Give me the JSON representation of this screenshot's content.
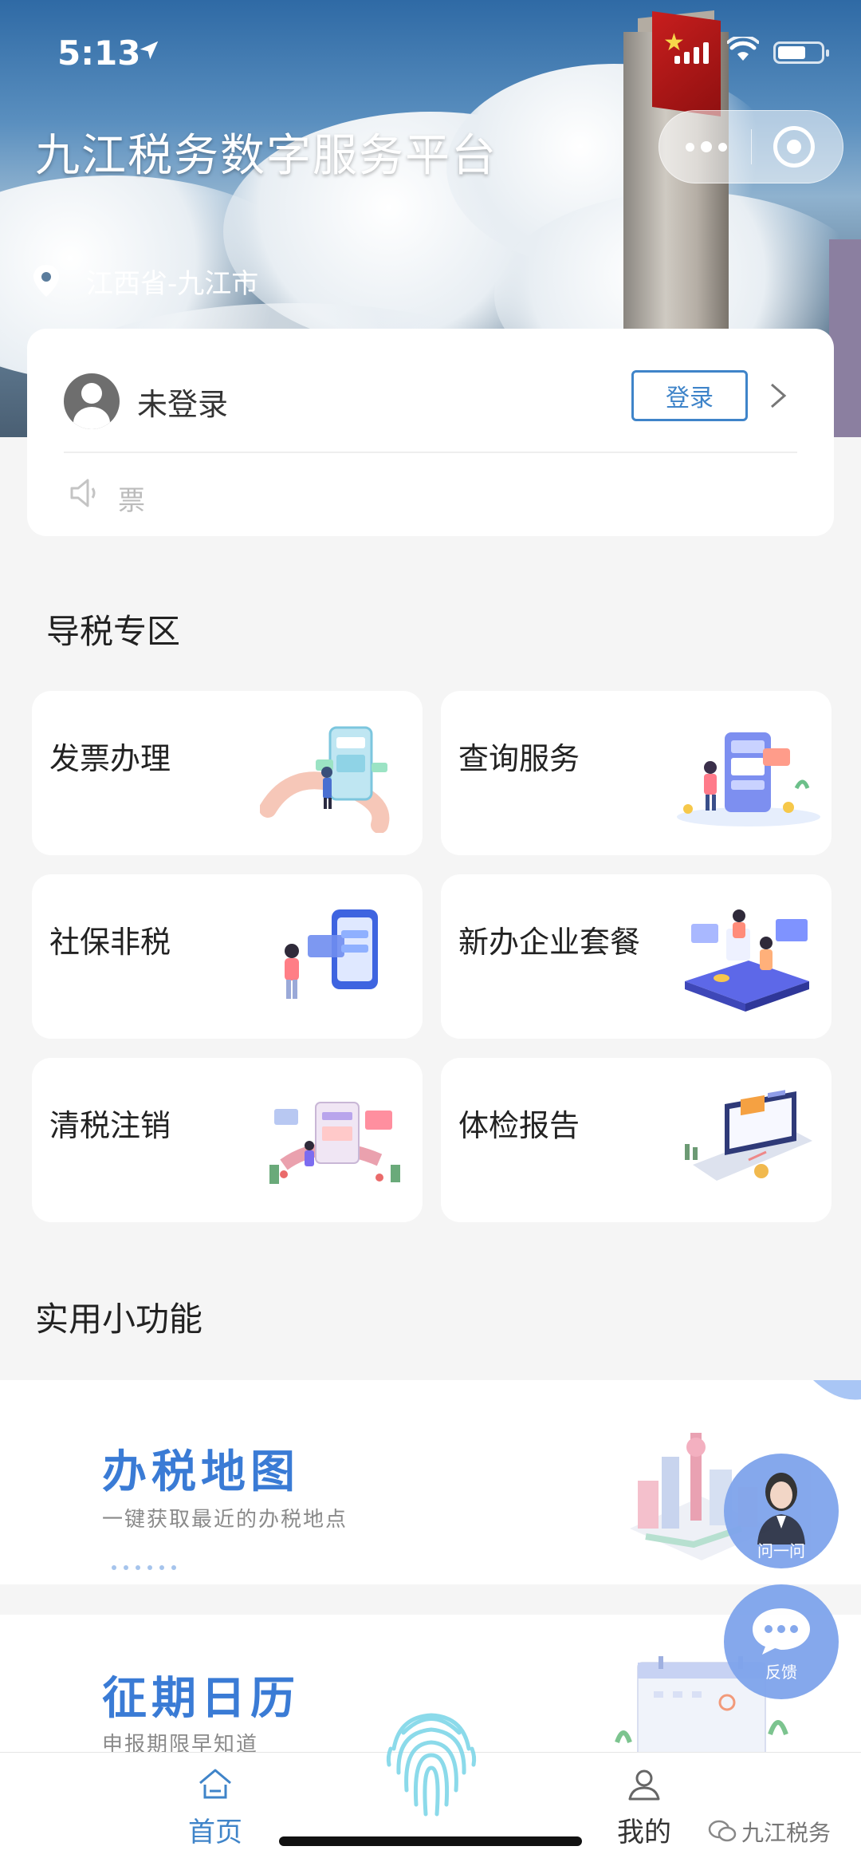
{
  "status_bar": {
    "time": "5:13"
  },
  "header": {
    "title": "九江税务数字服务平台",
    "location": "江西省-九江市"
  },
  "user": {
    "name": "未登录",
    "login_label": "登录",
    "notice": "票"
  },
  "guide_section": {
    "title": "导税专区",
    "tiles": [
      {
        "label": "发票办理",
        "icon": "invoice-illustration"
      },
      {
        "label": "查询服务",
        "icon": "query-illustration"
      },
      {
        "label": "社保非税",
        "icon": "social-security-illustration"
      },
      {
        "label": "新办企业套餐",
        "icon": "new-business-illustration"
      },
      {
        "label": "清税注销",
        "icon": "tax-clearance-illustration"
      },
      {
        "label": "体检报告",
        "icon": "health-report-illustration"
      }
    ]
  },
  "tools_section": {
    "title": "实用小功能",
    "banners": [
      {
        "title": "办税地图",
        "subtitle": "一键获取最近的办税地点"
      },
      {
        "title": "征期日历",
        "subtitle": "申报期限早知道"
      }
    ]
  },
  "floating": {
    "ask_label": "问一问",
    "feedback_label": "反馈"
  },
  "tab_bar": {
    "items": [
      {
        "label": "首页",
        "active": true
      },
      {
        "label": "我的",
        "active": false
      }
    ]
  },
  "watermark": "九江税务",
  "colors": {
    "accent": "#3f84c9",
    "banner_title": "#3a7bd5",
    "float": "#7fa4ec"
  }
}
